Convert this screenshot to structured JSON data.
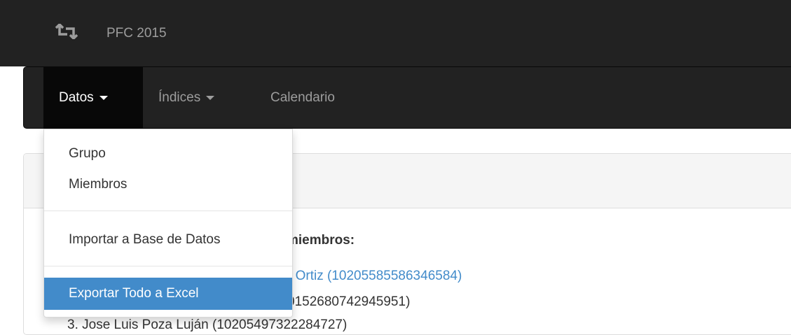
{
  "topbar": {
    "logo_icon": "retweet-icon",
    "brand": "PFC 2015"
  },
  "navbar": {
    "items": [
      {
        "label": "Datos",
        "has_caret": true,
        "active": true
      },
      {
        "label": "Índices",
        "has_caret": true,
        "active": false
      },
      {
        "label": "Calendario",
        "has_caret": false,
        "active": false
      }
    ]
  },
  "dropdown": {
    "items": [
      {
        "label": "Grupo"
      },
      {
        "label": "Miembros"
      },
      {
        "label": "Importar a Base de Datos"
      },
      {
        "label": "Exportar Todo a Excel",
        "highlighted": true
      }
    ]
  },
  "panel": {
    "heading_partial": "miembros:",
    "members": [
      {
        "text": "r Ortiz (10205585586346584)",
        "link": true
      },
      {
        "text": "0152680742945951)",
        "link": false
      },
      {
        "text": "3.   Jose Luis Poza Luján (10205497322284727)",
        "link": false
      }
    ]
  },
  "colors": {
    "topbar_bg": "#222222",
    "nav_active_bg": "#080808",
    "link": "#428bca",
    "dropdown_active_bg": "#428bca"
  }
}
